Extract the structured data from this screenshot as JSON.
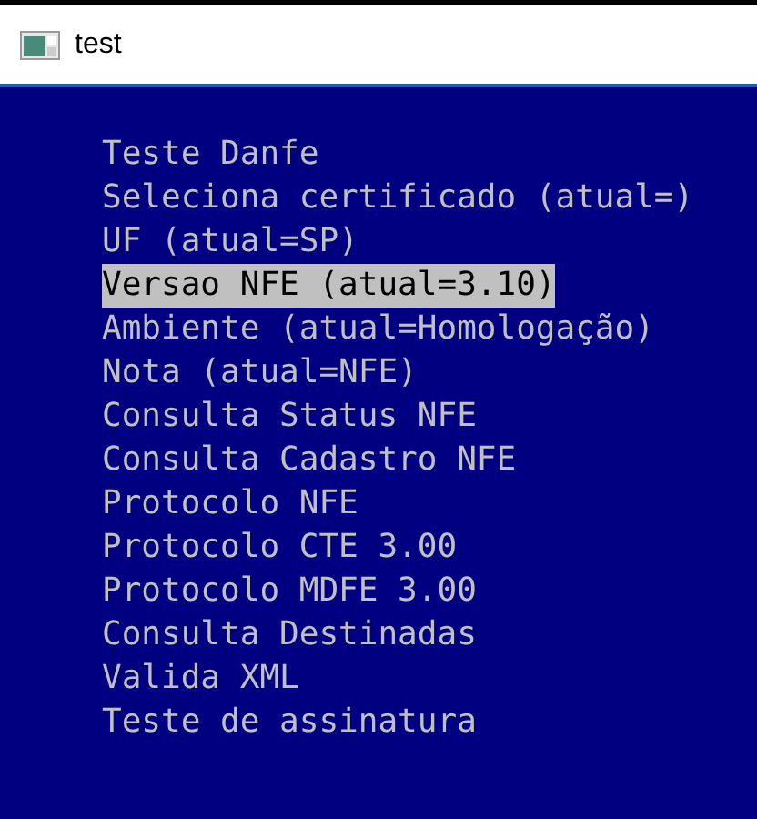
{
  "window": {
    "title": "test"
  },
  "menu": [
    {
      "label": "Teste Danfe",
      "selected": false
    },
    {
      "label": "Seleciona certificado (atual=)",
      "selected": false
    },
    {
      "label": "UF (atual=SP)",
      "selected": false
    },
    {
      "label": "Versao NFE (atual=3.10)",
      "selected": true
    },
    {
      "label": "Ambiente (atual=Homologação)",
      "selected": false
    },
    {
      "label": "Nota (atual=NFE)",
      "selected": false
    },
    {
      "label": "Consulta Status NFE",
      "selected": false
    },
    {
      "label": "Consulta Cadastro NFE",
      "selected": false
    },
    {
      "label": "Protocolo NFE",
      "selected": false
    },
    {
      "label": "Protocolo CTE 3.00",
      "selected": false
    },
    {
      "label": "Protocolo MDFE 3.00",
      "selected": false
    },
    {
      "label": "Consulta Destinadas",
      "selected": false
    },
    {
      "label": "Valida XML",
      "selected": false
    },
    {
      "label": "Teste de assinatura",
      "selected": false
    }
  ]
}
